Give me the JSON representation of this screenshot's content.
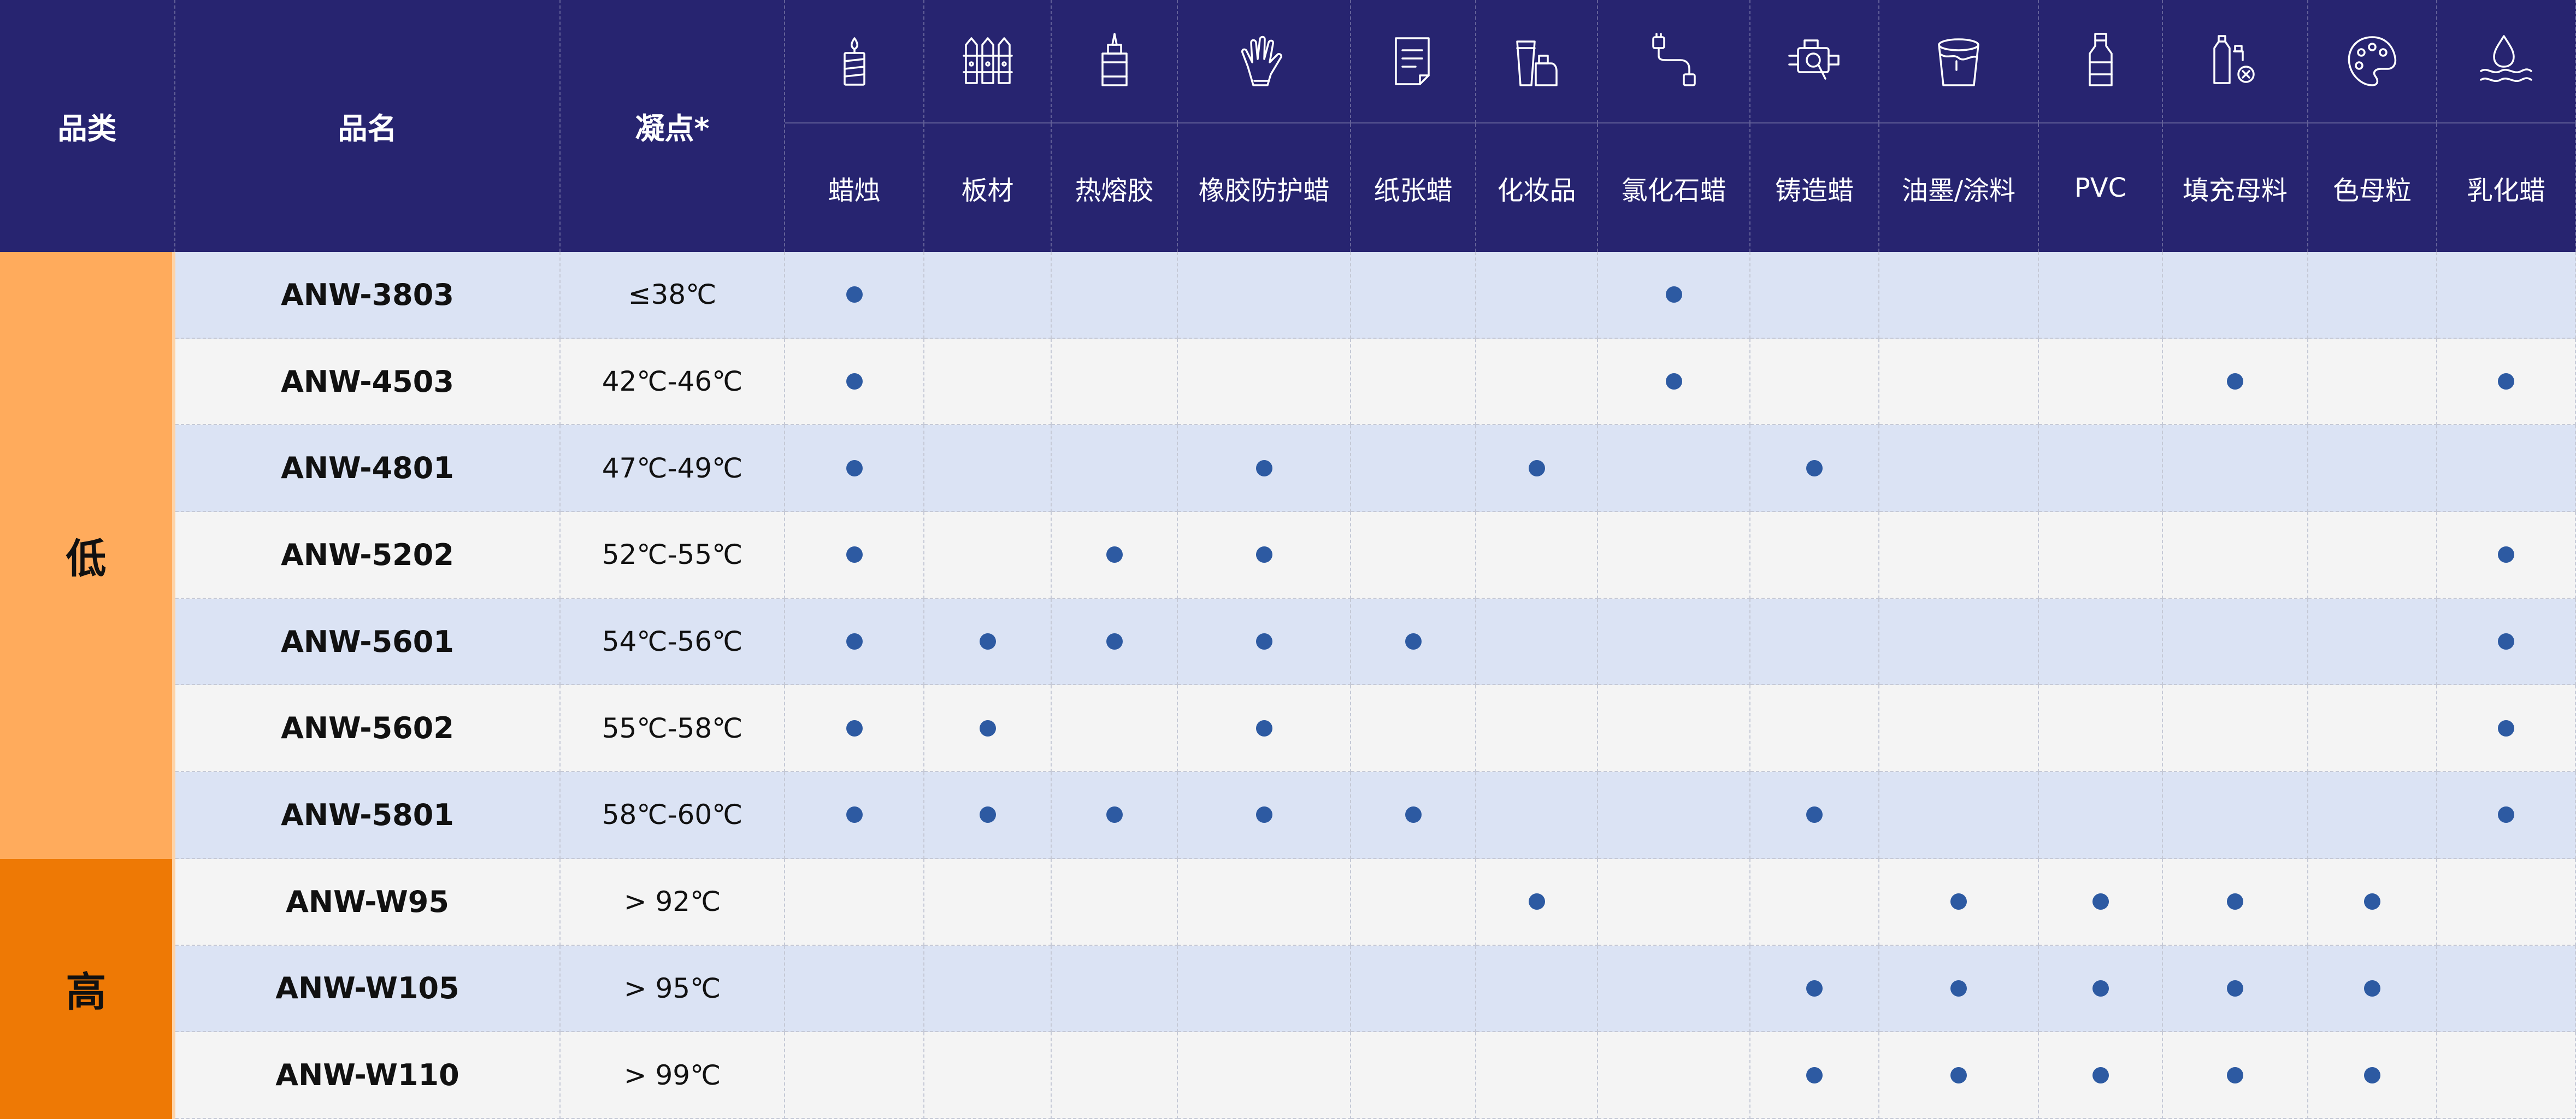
{
  "header": {
    "category": "品类",
    "name": "品名",
    "pour_point": "凝点*"
  },
  "colors": {
    "header_bg": "#272470",
    "low_bg": "#ffab5c",
    "high_bg": "#ee7905",
    "row_odd": "#dbe3f4",
    "row_even": "#f4f4f4",
    "dot": "#2d5aa2"
  },
  "applications": [
    {
      "label": "蜡烛",
      "icon": "candle-icon"
    },
    {
      "label": "板材",
      "icon": "board-icon"
    },
    {
      "label": "热熔胶",
      "icon": "glue-bottle-icon"
    },
    {
      "label": "橡胶防护蜡",
      "icon": "rubber-glove-icon"
    },
    {
      "label": "纸张蜡",
      "icon": "paper-icon"
    },
    {
      "label": "化妆品",
      "icon": "cosmetics-icon"
    },
    {
      "label": "氯化石蜡",
      "icon": "cable-icon"
    },
    {
      "label": "铸造蜡",
      "icon": "engine-icon"
    },
    {
      "label": "油墨/涂料",
      "icon": "paint-bucket-icon"
    },
    {
      "label": "PVC",
      "icon": "bottle-icon"
    },
    {
      "label": "填充母料",
      "icon": "recycle-bottles-icon"
    },
    {
      "label": "色母粒",
      "icon": "palette-icon"
    },
    {
      "label": "乳化蜡",
      "icon": "water-drop-icon"
    }
  ],
  "categories": {
    "low": "低",
    "high": "高"
  },
  "products": [
    {
      "name": "ANW-3803",
      "pour_point": "≤38℃",
      "category": "low",
      "apps": [
        1,
        0,
        0,
        0,
        0,
        0,
        1,
        0,
        0,
        0,
        0,
        0,
        0
      ]
    },
    {
      "name": "ANW-4503",
      "pour_point": "42℃-46℃",
      "category": "low",
      "apps": [
        1,
        0,
        0,
        0,
        0,
        0,
        1,
        0,
        0,
        0,
        1,
        0,
        1
      ]
    },
    {
      "name": "ANW-4801",
      "pour_point": "47℃-49℃",
      "category": "low",
      "apps": [
        1,
        0,
        0,
        1,
        0,
        1,
        0,
        1,
        0,
        0,
        0,
        0,
        0
      ]
    },
    {
      "name": "ANW-5202",
      "pour_point": "52℃-55℃",
      "category": "low",
      "apps": [
        1,
        0,
        1,
        1,
        0,
        0,
        0,
        0,
        0,
        0,
        0,
        0,
        1
      ]
    },
    {
      "name": "ANW-5601",
      "pour_point": "54℃-56℃",
      "category": "low",
      "apps": [
        1,
        1,
        1,
        1,
        1,
        0,
        0,
        0,
        0,
        0,
        0,
        0,
        1
      ]
    },
    {
      "name": "ANW-5602",
      "pour_point": "55℃-58℃",
      "category": "low",
      "apps": [
        1,
        1,
        0,
        1,
        0,
        0,
        0,
        0,
        0,
        0,
        0,
        0,
        1
      ]
    },
    {
      "name": "ANW-5801",
      "pour_point": "58℃-60℃",
      "category": "low",
      "apps": [
        1,
        1,
        1,
        1,
        1,
        0,
        0,
        1,
        0,
        0,
        0,
        0,
        1
      ]
    },
    {
      "name": "ANW-W95",
      "pour_point": "> 92℃",
      "category": "high",
      "apps": [
        0,
        0,
        0,
        0,
        0,
        1,
        0,
        0,
        1,
        1,
        1,
        1,
        0
      ]
    },
    {
      "name": "ANW-W105",
      "pour_point": "> 95℃",
      "category": "high",
      "apps": [
        0,
        0,
        0,
        0,
        0,
        0,
        0,
        1,
        1,
        1,
        1,
        1,
        0
      ]
    },
    {
      "name": "ANW-W110",
      "pour_point": "> 99℃",
      "category": "high",
      "apps": [
        0,
        0,
        0,
        0,
        0,
        0,
        0,
        1,
        1,
        1,
        1,
        1,
        0
      ]
    }
  ]
}
